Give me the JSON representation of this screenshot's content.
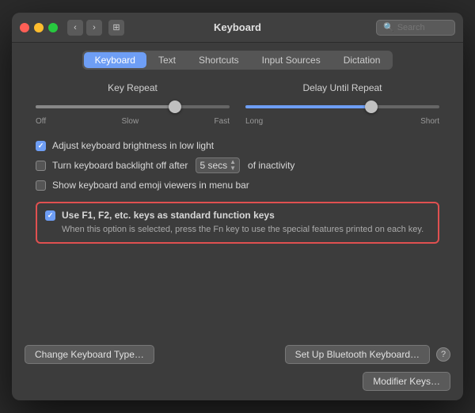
{
  "window": {
    "title": "Keyboard"
  },
  "search": {
    "placeholder": "Search"
  },
  "tabs": [
    {
      "id": "keyboard",
      "label": "Keyboard",
      "active": true
    },
    {
      "id": "text",
      "label": "Text",
      "active": false
    },
    {
      "id": "shortcuts",
      "label": "Shortcuts",
      "active": false
    },
    {
      "id": "input-sources",
      "label": "Input Sources",
      "active": false
    },
    {
      "id": "dictation",
      "label": "Dictation",
      "active": false
    }
  ],
  "sliders": [
    {
      "label": "Key Repeat",
      "leftMark": "Off",
      "midMark": "Slow",
      "rightMark": "Fast",
      "thumbPercent": 72
    },
    {
      "label": "Delay Until Repeat",
      "leftMark": "Long",
      "rightMark": "Short",
      "thumbPercent": 65
    }
  ],
  "options": [
    {
      "id": "brightness",
      "label": "Adjust keyboard brightness in low light",
      "checked": true,
      "hasSelect": false
    },
    {
      "id": "backlight",
      "label": "Turn keyboard backlight off after",
      "checked": false,
      "hasSelect": true,
      "selectValue": "5 secs",
      "afterSelectLabel": "of inactivity"
    },
    {
      "id": "emoji",
      "label": "Show keyboard and emoji viewers in menu bar",
      "checked": false,
      "hasSelect": false
    }
  ],
  "highlightedOption": {
    "label": "Use F1, F2, etc. keys as standard function keys",
    "checked": true,
    "hint": "When this option is selected, press the Fn key to use the special features printed on each key."
  },
  "bottomButtons": {
    "left": "Change Keyboard Type…",
    "right": "Modifier Keys…",
    "bluetooth": "Set Up Bluetooth Keyboard…"
  }
}
